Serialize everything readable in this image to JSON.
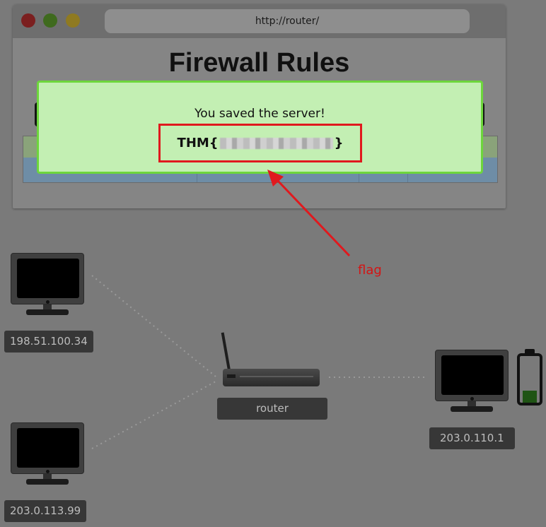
{
  "browser": {
    "url": "http://router/",
    "page_title": "Firewall Rules"
  },
  "modal": {
    "message": "You saved the server!",
    "flag_prefix": "THM{",
    "flag_suffix": "}"
  },
  "annotation": {
    "label": "flag"
  },
  "network": {
    "hosts": [
      {
        "ip": "198.51.100.34"
      },
      {
        "ip": "203.0.113.99"
      },
      {
        "ip": "203.0.110.1"
      }
    ],
    "router_label": "router",
    "battery_level": 0.3
  },
  "colors": {
    "modal_bg": "#c3efb3",
    "modal_border": "#6dd63c",
    "highlight_red": "#e0191e",
    "battery_fill": "#1f5414"
  }
}
